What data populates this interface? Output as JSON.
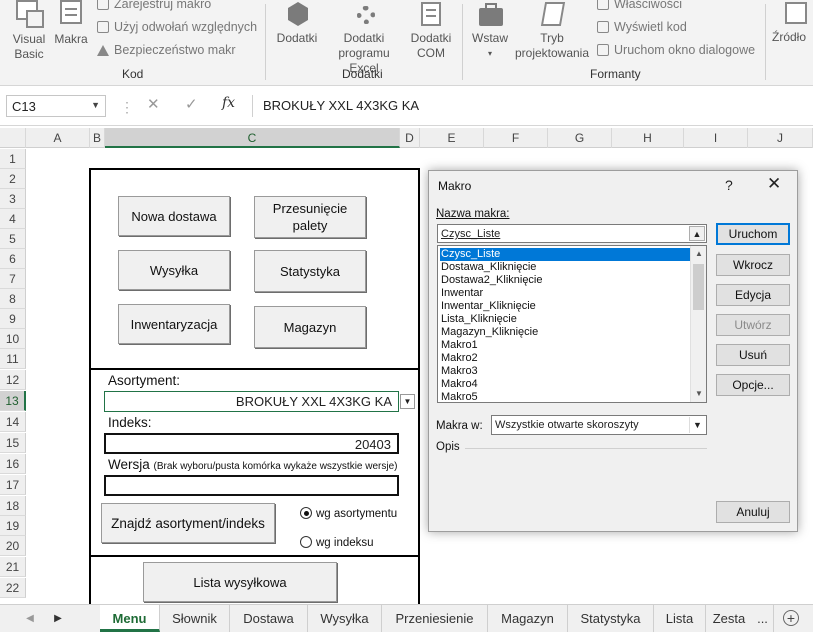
{
  "ribbon": {
    "kod": {
      "visual_basic": [
        "Visual",
        "Basic"
      ],
      "makra": "Makra",
      "record": "Zarejestruj makro",
      "relative": "Użyj odwołań względnych",
      "security": "Bezpieczeństwo makr",
      "label": "Kod"
    },
    "dodatki": {
      "dodatki": "Dodatki",
      "excel": [
        "Dodatki",
        "programu Excel"
      ],
      "com": [
        "Dodatki",
        "COM"
      ],
      "label": "Dodatki"
    },
    "formanty": {
      "wstaw": "Wstaw",
      "tryb": [
        "Tryb",
        "projektowania"
      ],
      "wlasciwosci": "Właściwości",
      "wyswietl": "Wyświetl kod",
      "uruchom_okno": "Uruchom okno dialogowe",
      "label": "Formanty"
    },
    "zrodlo": "Źródło"
  },
  "formula_bar": {
    "name_box": "C13",
    "cancel_glyph": "✕",
    "confirm_glyph": "✓",
    "fx": "fx",
    "value": "BROKUŁY XXL 4X3KG KA"
  },
  "columns": [
    "A",
    "B",
    "C",
    "D",
    "E",
    "F",
    "G",
    "H",
    "I",
    "J"
  ],
  "rows": [
    "1",
    "2",
    "3",
    "4",
    "5",
    "6",
    "7",
    "8",
    "9",
    "10",
    "11",
    "12",
    "13",
    "14",
    "15",
    "16",
    "17",
    "18",
    "19",
    "20",
    "21",
    "22"
  ],
  "sheet": {
    "buttons": {
      "nowa_dostawa": "Nowa dostawa",
      "przesuniecie": [
        "Przesunięcie",
        "palety"
      ],
      "wysylka": "Wysyłka",
      "statystyka": "Statystyka",
      "inwentaryzacja": "Inwentaryzacja",
      "magazyn": "Magazyn",
      "znajdz": "Znajdź asortyment/indeks",
      "lista": "Lista wysyłkowa"
    },
    "asortyment_label": "Asortyment:",
    "asortyment_value": "BROKUŁY XXL 4X3KG KA",
    "indeks_label": "Indeks:",
    "indeks_value": "20403",
    "wersja_label": "Wersja",
    "wersja_note": "(Brak wyboru/pusta komórka wykaże wszystkie wersje)",
    "wersja_value": "",
    "radio_asort": "wg asortymentu",
    "radio_indeks": "wg indeksu"
  },
  "dialog": {
    "title": "Makro",
    "help": "?",
    "close": "✕",
    "name_label": "Nazwa makra:",
    "name_value": "Czysc_Liste",
    "list": [
      "Czysc_Liste",
      "Dostawa_Kliknięcie",
      "Dostawa2_Kliknięcie",
      "Inwentar",
      "Inwentar_Kliknięcie",
      "Lista_Kliknięcie",
      "Magazyn_Kliknięcie",
      "Makro1",
      "Makro2",
      "Makro3",
      "Makro4",
      "Makro5"
    ],
    "buttons": {
      "uruchom": "Uruchom",
      "wkrocz": "Wkrocz",
      "edycja": "Edycja",
      "utworz": "Utwórz",
      "usun": "Usuń",
      "opcje": "Opcje...",
      "anuluj": "Anuluj"
    },
    "makra_w_label": "Makra w:",
    "makra_w_value": "Wszystkie otwarte skoroszyty",
    "opis_label": "Opis"
  },
  "tabs": [
    "Menu",
    "Słownik",
    "Dostawa",
    "Wysyłka",
    "Przeniesienie",
    "Magazyn",
    "Statystyka",
    "Lista",
    "Zesta"
  ],
  "tab_more": "...",
  "tab_add": "+",
  "colors": {
    "excel_green": "#217346",
    "selection_blue": "#0078d7"
  }
}
